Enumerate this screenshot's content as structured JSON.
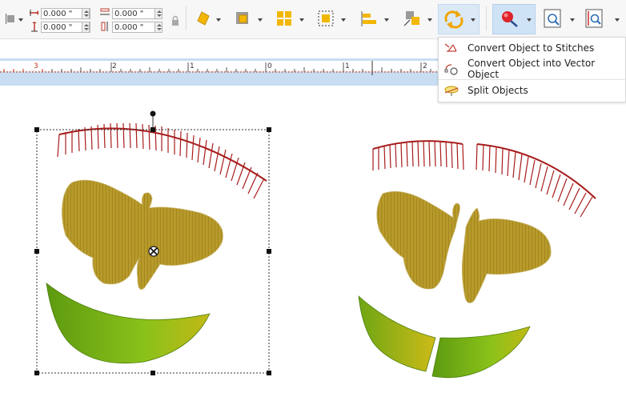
{
  "toolbar": {
    "fields": {
      "pos_x": "0.000 \"",
      "pos_y": "0.000 \"",
      "width": "0.000 \"",
      "height": "0.000 \""
    },
    "icons": [
      "align-left-icon",
      "lock-icon",
      "rotate-diamond-icon",
      "arrange-order-icon",
      "group-objects-icon",
      "ungroup-objects-icon",
      "align-objects-icon",
      "distribute-objects-icon",
      "convert-object-icon",
      "magic-wand-icon",
      "zoom-icon",
      "zoom-measure-icon"
    ]
  },
  "ruler": {
    "labels": [
      "3",
      "2",
      "1",
      "0",
      "1",
      "2"
    ]
  },
  "dropdown_menu": {
    "items": [
      {
        "label": "Convert Object to Stitches",
        "icon": "convert-to-stitches-icon"
      },
      {
        "label": "Convert Object into Vector Object",
        "icon": "convert-to-vector-icon"
      },
      {
        "label": "Split Objects",
        "icon": "split-objects-icon"
      }
    ]
  },
  "colors": {
    "toolbar_bg": "#f7f7f7",
    "active_button": "#cfe3f6",
    "ruler_bg": "#c8ddf2",
    "lash_red": "#a81c1c",
    "butterfly_gold": "#b79a2a",
    "leaf_green": "#7cb713"
  }
}
